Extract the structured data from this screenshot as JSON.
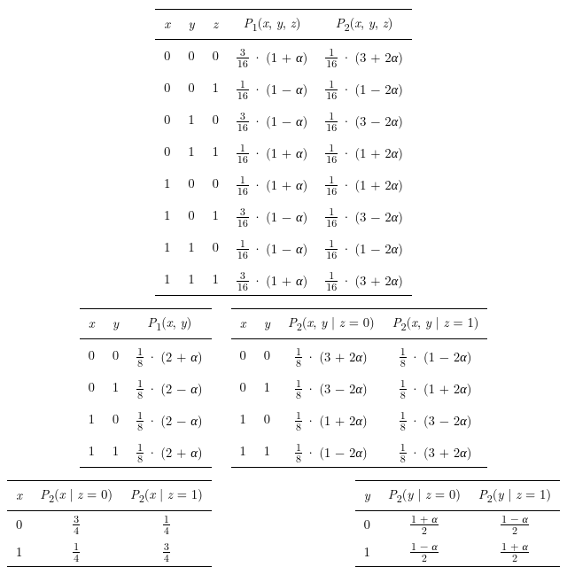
{
  "vars": {
    "x": "x",
    "y": "y",
    "z": "z",
    "alpha": "α"
  },
  "table1": {
    "headers": {
      "x": "x",
      "y": "y",
      "z": "z",
      "P1": "P₁(x, y, z)",
      "P2": "P₂(x, y, z)"
    },
    "rows": [
      {
        "x": "0",
        "y": "0",
        "z": "0",
        "p1": {
          "num": "3",
          "den": "16",
          "factor": "(1 + α)"
        },
        "p2": {
          "num": "1",
          "den": "16",
          "factor": "(3 + 2α)"
        }
      },
      {
        "x": "0",
        "y": "0",
        "z": "1",
        "p1": {
          "num": "1",
          "den": "16",
          "factor": "(1 − α)"
        },
        "p2": {
          "num": "1",
          "den": "16",
          "factor": "(1 − 2α)"
        }
      },
      {
        "x": "0",
        "y": "1",
        "z": "0",
        "p1": {
          "num": "3",
          "den": "16",
          "factor": "(1 − α)"
        },
        "p2": {
          "num": "1",
          "den": "16",
          "factor": "(3 − 2α)"
        }
      },
      {
        "x": "0",
        "y": "1",
        "z": "1",
        "p1": {
          "num": "1",
          "den": "16",
          "factor": "(1 + α)"
        },
        "p2": {
          "num": "1",
          "den": "16",
          "factor": "(1 + 2α)"
        }
      },
      {
        "x": "1",
        "y": "0",
        "z": "0",
        "p1": {
          "num": "1",
          "den": "16",
          "factor": "(1 + α)"
        },
        "p2": {
          "num": "1",
          "den": "16",
          "factor": "(1 + 2α)"
        }
      },
      {
        "x": "1",
        "y": "0",
        "z": "1",
        "p1": {
          "num": "3",
          "den": "16",
          "factor": "(1 − α)"
        },
        "p2": {
          "num": "1",
          "den": "16",
          "factor": "(3 − 2α)"
        }
      },
      {
        "x": "1",
        "y": "1",
        "z": "0",
        "p1": {
          "num": "1",
          "den": "16",
          "factor": "(1 − α)"
        },
        "p2": {
          "num": "1",
          "den": "16",
          "factor": "(1 − 2α)"
        }
      },
      {
        "x": "1",
        "y": "1",
        "z": "1",
        "p1": {
          "num": "3",
          "den": "16",
          "factor": "(1 + α)"
        },
        "p2": {
          "num": "1",
          "den": "16",
          "factor": "(3 + 2α)"
        }
      }
    ]
  },
  "table2": {
    "headers": {
      "x": "x",
      "y": "y",
      "P1": "P₁(x, y)"
    },
    "rows": [
      {
        "x": "0",
        "y": "0",
        "p": {
          "num": "1",
          "den": "8",
          "factor": "(2 + α)"
        }
      },
      {
        "x": "0",
        "y": "1",
        "p": {
          "num": "1",
          "den": "8",
          "factor": "(2 − α)"
        }
      },
      {
        "x": "1",
        "y": "0",
        "p": {
          "num": "1",
          "den": "8",
          "factor": "(2 − α)"
        }
      },
      {
        "x": "1",
        "y": "1",
        "p": {
          "num": "1",
          "den": "8",
          "factor": "(2 + α)"
        }
      }
    ]
  },
  "table3": {
    "headers": {
      "x": "x",
      "y": "y",
      "P2z0": "P₂(x, y | z = 0)",
      "P2z1": "P₂(x, y | z = 1)"
    },
    "rows": [
      {
        "x": "0",
        "y": "0",
        "z0": {
          "num": "1",
          "den": "8",
          "factor": "(3 + 2α)"
        },
        "z1": {
          "num": "1",
          "den": "8",
          "factor": "(1 − 2α)"
        }
      },
      {
        "x": "0",
        "y": "1",
        "z0": {
          "num": "1",
          "den": "8",
          "factor": "(3 − 2α)"
        },
        "z1": {
          "num": "1",
          "den": "8",
          "factor": "(1 + 2α)"
        }
      },
      {
        "x": "1",
        "y": "0",
        "z0": {
          "num": "1",
          "den": "8",
          "factor": "(1 + 2α)"
        },
        "z1": {
          "num": "1",
          "den": "8",
          "factor": "(3 − 2α)"
        }
      },
      {
        "x": "1",
        "y": "1",
        "z0": {
          "num": "1",
          "den": "8",
          "factor": "(1 − 2α)"
        },
        "z1": {
          "num": "1",
          "den": "8",
          "factor": "(3 + 2α)"
        }
      }
    ]
  },
  "table4": {
    "headers": {
      "x": "x",
      "P2z0": "P₂(x | z = 0)",
      "P2z1": "P₂(x | z = 1)"
    },
    "rows": [
      {
        "x": "0",
        "z0": {
          "num": "3",
          "den": "4"
        },
        "z1": {
          "num": "1",
          "den": "4"
        }
      },
      {
        "x": "1",
        "z0": {
          "num": "1",
          "den": "4"
        },
        "z1": {
          "num": "3",
          "den": "4"
        }
      }
    ]
  },
  "table5": {
    "headers": {
      "y": "y",
      "P2z0": "P₂(y | z = 0)",
      "P2z1": "P₂(y | z = 1)"
    },
    "rows": [
      {
        "y": "0",
        "z0": {
          "num": "1 + α",
          "den": "2"
        },
        "z1": {
          "num": "1 − α",
          "den": "2"
        }
      },
      {
        "y": "1",
        "z0": {
          "num": "1 − α",
          "den": "2"
        },
        "z1": {
          "num": "1 + α",
          "den": "2"
        }
      }
    ]
  },
  "chart_data": [
    {
      "type": "table",
      "title": "Joint P1 and P2 over (x,y,z)"
    },
    {
      "type": "table",
      "title": "Marginal P1(x,y)"
    },
    {
      "type": "table",
      "title": "Conditional P2(x,y|z)"
    },
    {
      "type": "table",
      "title": "Conditional P2(x|z)"
    },
    {
      "type": "table",
      "title": "Conditional P2(y|z)"
    }
  ]
}
